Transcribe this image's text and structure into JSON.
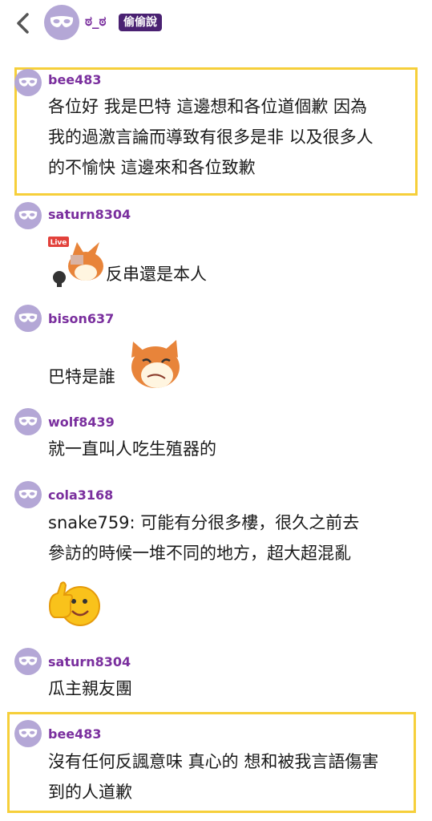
{
  "header": {
    "title": "ಠ_ಠ",
    "badge": "偷偷說"
  },
  "messages": [
    {
      "user": "bee483",
      "lines": [
        "各位好 我是巴特 這邊想和各位道個歉 因為",
        "我的過激言論而導致有很多是非 以及很多人",
        "的不愉快 這邊來和各位致歉"
      ]
    },
    {
      "user": "saturn8304",
      "lines": [
        "反串還是本人"
      ],
      "sticker_label": "Live"
    },
    {
      "user": "bison637",
      "lines": [
        "巴特是誰"
      ]
    },
    {
      "user": "wolf8439",
      "lines": [
        "就一直叫人吃生殖器的"
      ]
    },
    {
      "user": "cola3168",
      "lines": [
        "snake759: 可能有分很多樓，很久之前去",
        "參訪的時候一堆不同的地方，超大超混亂"
      ]
    },
    {
      "user": "saturn8304",
      "lines": [
        "瓜主親友團"
      ]
    },
    {
      "user": "bee483",
      "lines": [
        "沒有任何反諷意味 真心的 想和被我言語傷害",
        "到的人道歉"
      ]
    }
  ],
  "colors": {
    "accent": "#7a2f9e",
    "badge_bg": "#4a2172",
    "highlight": "#f6cf3a",
    "avatar_bg": "#b4a7d6"
  },
  "icons": {
    "back": "chevron-left-icon",
    "avatar": "mask-icon"
  }
}
